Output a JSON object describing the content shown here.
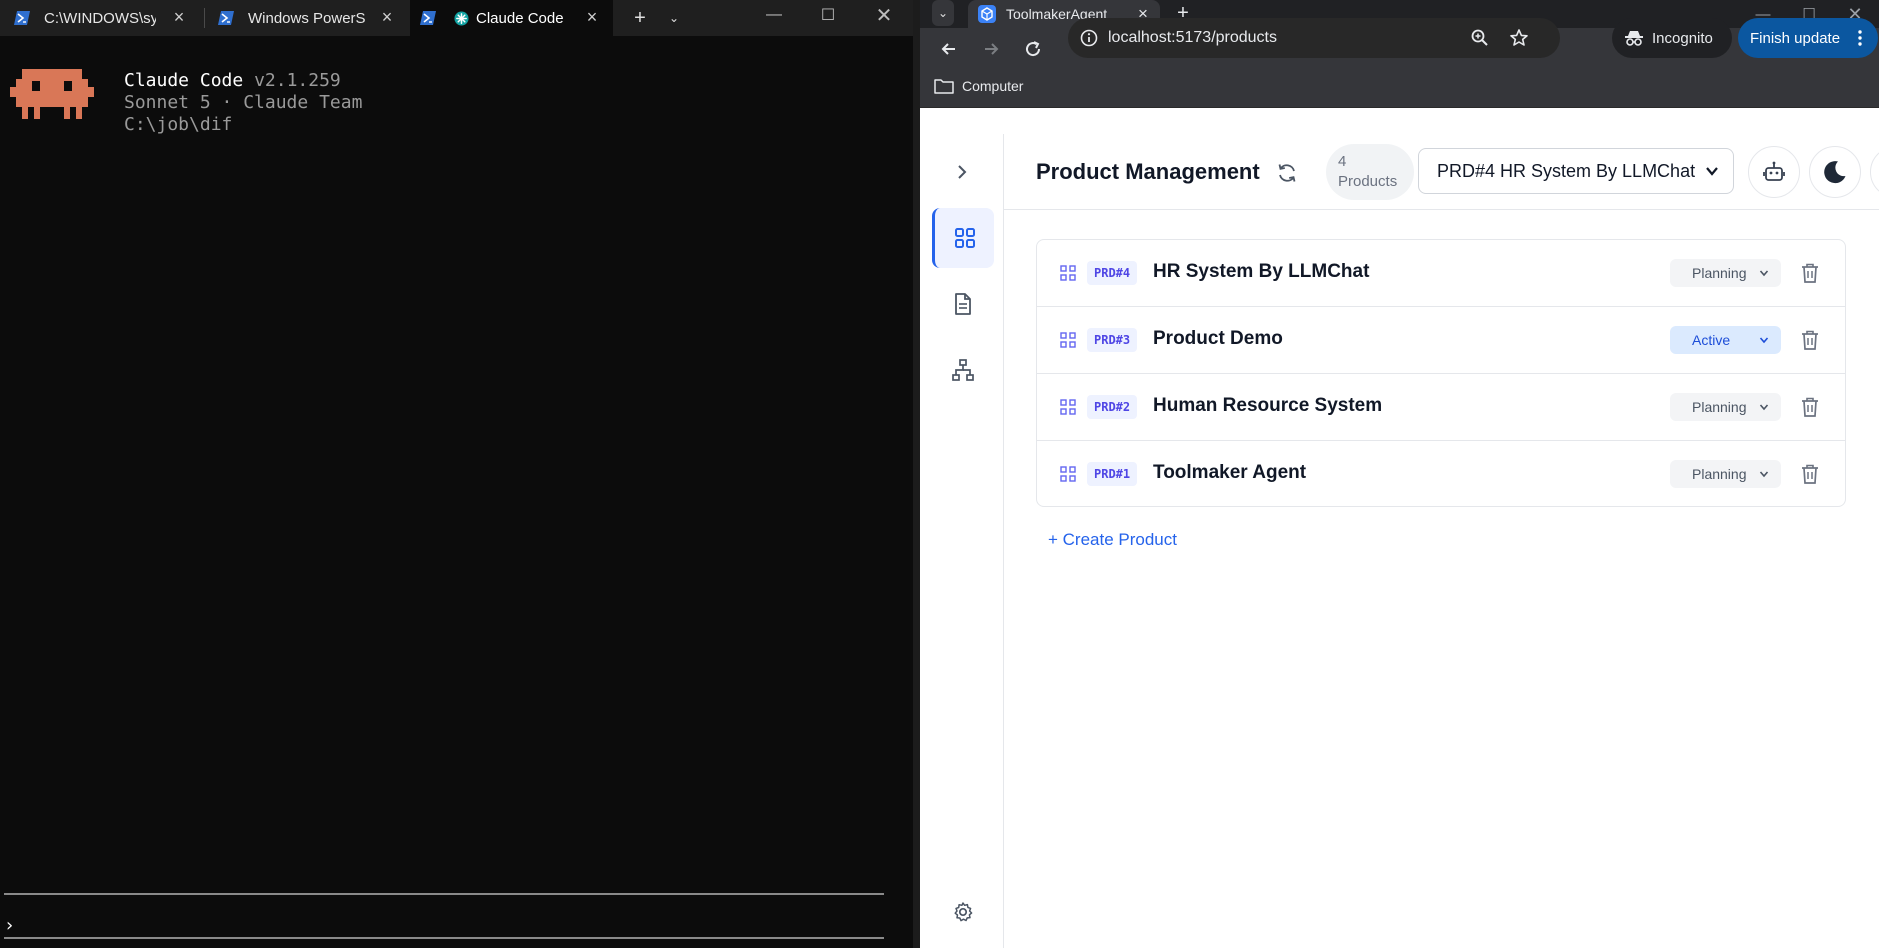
{
  "terminal": {
    "tabs": [
      {
        "label": "C:\\WINDOWS\\syst"
      },
      {
        "label": "Windows PowerSh"
      },
      {
        "label": "Claude Code"
      }
    ],
    "app_name": "Claude Code",
    "version": "v2.1.259",
    "model_line": "Sonnet 5 · Claude Team",
    "cwd": "C:\\job\\dif",
    "prompt_symbol": "›",
    "mascot_color": "#d97757"
  },
  "browser": {
    "tab_title": "ToolmakerAgent",
    "url": "localhost:5173/products",
    "incognito_label": "Incognito",
    "update_label": "Finish update",
    "bookmark_folder": "Computer"
  },
  "app": {
    "title": "Product Management",
    "count_number": "4",
    "count_unit": "Products",
    "selected_product": "PRD#4 HR System By LLMChat",
    "create_label": "+ Create Product",
    "accent_color": "#2563eb",
    "products": [
      {
        "id": "PRD#4",
        "name": "HR System By LLMChat",
        "status": "Planning"
      },
      {
        "id": "PRD#3",
        "name": "Product Demo",
        "status": "Active"
      },
      {
        "id": "PRD#2",
        "name": "Human Resource System",
        "status": "Planning"
      },
      {
        "id": "PRD#1",
        "name": "Toolmaker Agent",
        "status": "Planning"
      }
    ]
  }
}
